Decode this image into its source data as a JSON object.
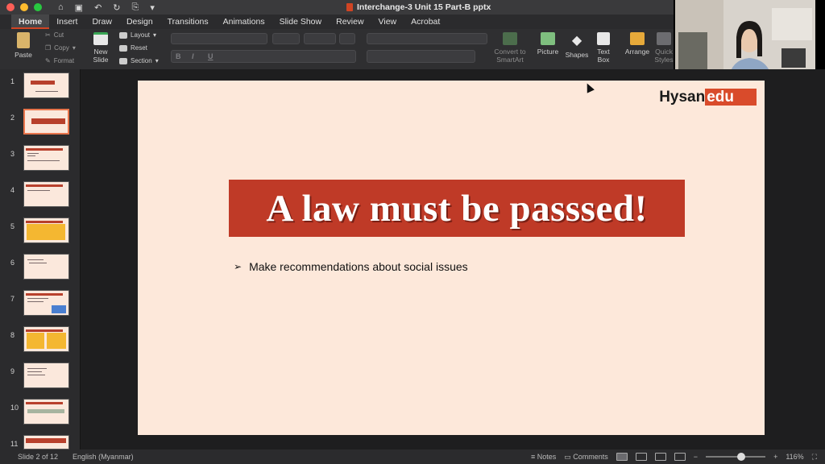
{
  "window": {
    "title": "Interchange-3 Unit 15 Part-B pptx"
  },
  "ribbon_tabs": [
    "Home",
    "Insert",
    "Draw",
    "Design",
    "Transitions",
    "Animations",
    "Slide Show",
    "Review",
    "View",
    "Acrobat"
  ],
  "active_tab": "Home",
  "ribbon": {
    "paste": "Paste",
    "cut": "Cut",
    "copy": "Copy",
    "format": "Format",
    "new_slide_1": "New",
    "new_slide_2": "Slide",
    "layout": "Layout",
    "reset": "Reset",
    "section": "Section",
    "convert_1": "Convert to",
    "convert_2": "SmartArt",
    "picture": "Picture",
    "shapes": "Shapes",
    "textbox_1": "Text",
    "textbox_2": "Box",
    "arrange": "Arrange",
    "quick_styles_1": "Quick",
    "quick_styles_2": "Styles"
  },
  "thumbnails": [
    {
      "num": "1"
    },
    {
      "num": "2"
    },
    {
      "num": "3"
    },
    {
      "num": "4"
    },
    {
      "num": "5"
    },
    {
      "num": "6"
    },
    {
      "num": "7"
    },
    {
      "num": "8"
    },
    {
      "num": "9"
    },
    {
      "num": "10"
    },
    {
      "num": "11"
    }
  ],
  "selected_slide": 2,
  "slide": {
    "logo_left": "Hysan",
    "logo_right": "edu",
    "title": "A law must be passsed!",
    "bullet": "Make recommendations about social issues"
  },
  "status": {
    "slide_info": "Slide 2 of 12",
    "language": "English (Myanmar)",
    "notes": "Notes",
    "comments": "Comments",
    "zoom": "116%",
    "zoom_level": 0.6
  },
  "colors": {
    "accent": "#d04423",
    "slide_bg": "#fde8da",
    "banner": "#bf3a27"
  }
}
